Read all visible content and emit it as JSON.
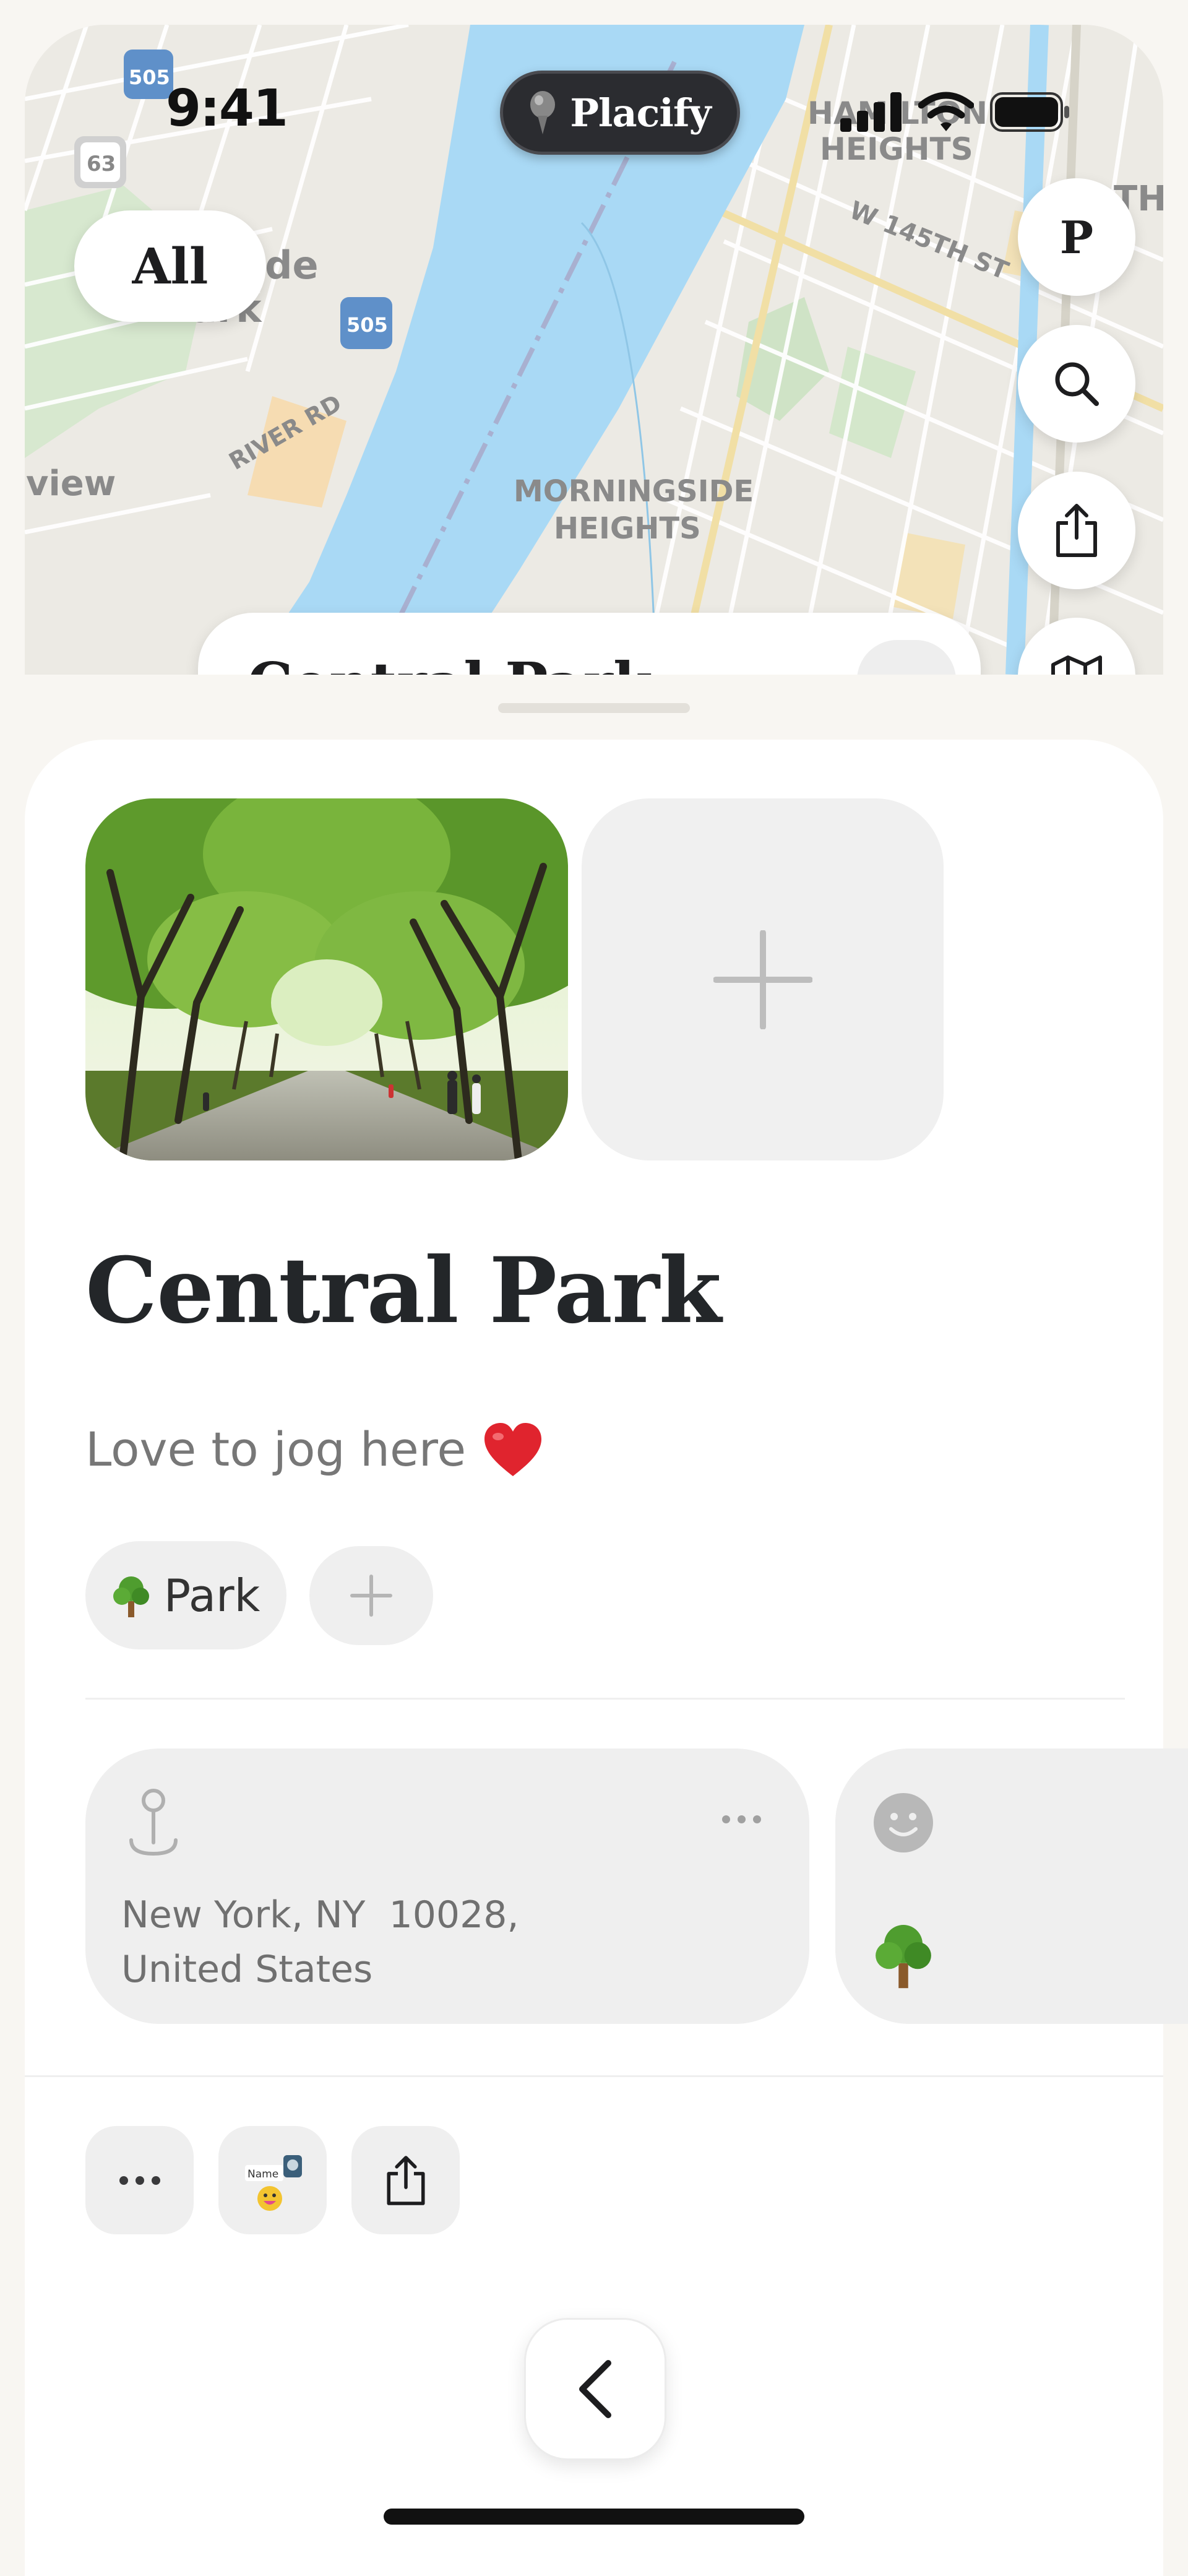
{
  "status_bar": {
    "time": "9:41"
  },
  "app": {
    "name": "Placify"
  },
  "map": {
    "filter_label": "All",
    "profile_initial": "P",
    "labels": {
      "hamilton": "HAMILTON\nHEIGHTS",
      "street": "W 145TH ST",
      "morningside": "MORNINGSIDE\nHEIGHTS",
      "riverside": "Riverside\nPark",
      "river_rd": "RIVER RD",
      "view": "view",
      "route_505": "505",
      "route_63": "63",
      "th": "TH"
    },
    "icons": [
      "search-icon",
      "share-icon",
      "map-icon"
    ]
  },
  "place": {
    "title": "Central Park",
    "note": "Love to jog here",
    "note_emoji": "❤️",
    "tag": {
      "emoji": "🌳",
      "label": "Park"
    },
    "address_line1": "New York, NY  10028,",
    "address_line2": "United States",
    "category_emoji": "🌳"
  },
  "actions": {
    "sticker_name_label": "Name"
  },
  "colors": {
    "water": "#a9d9f5",
    "accent_dark": "#2b2c30",
    "sheet_bg": "#ffffff",
    "card_bg": "#efefef"
  }
}
